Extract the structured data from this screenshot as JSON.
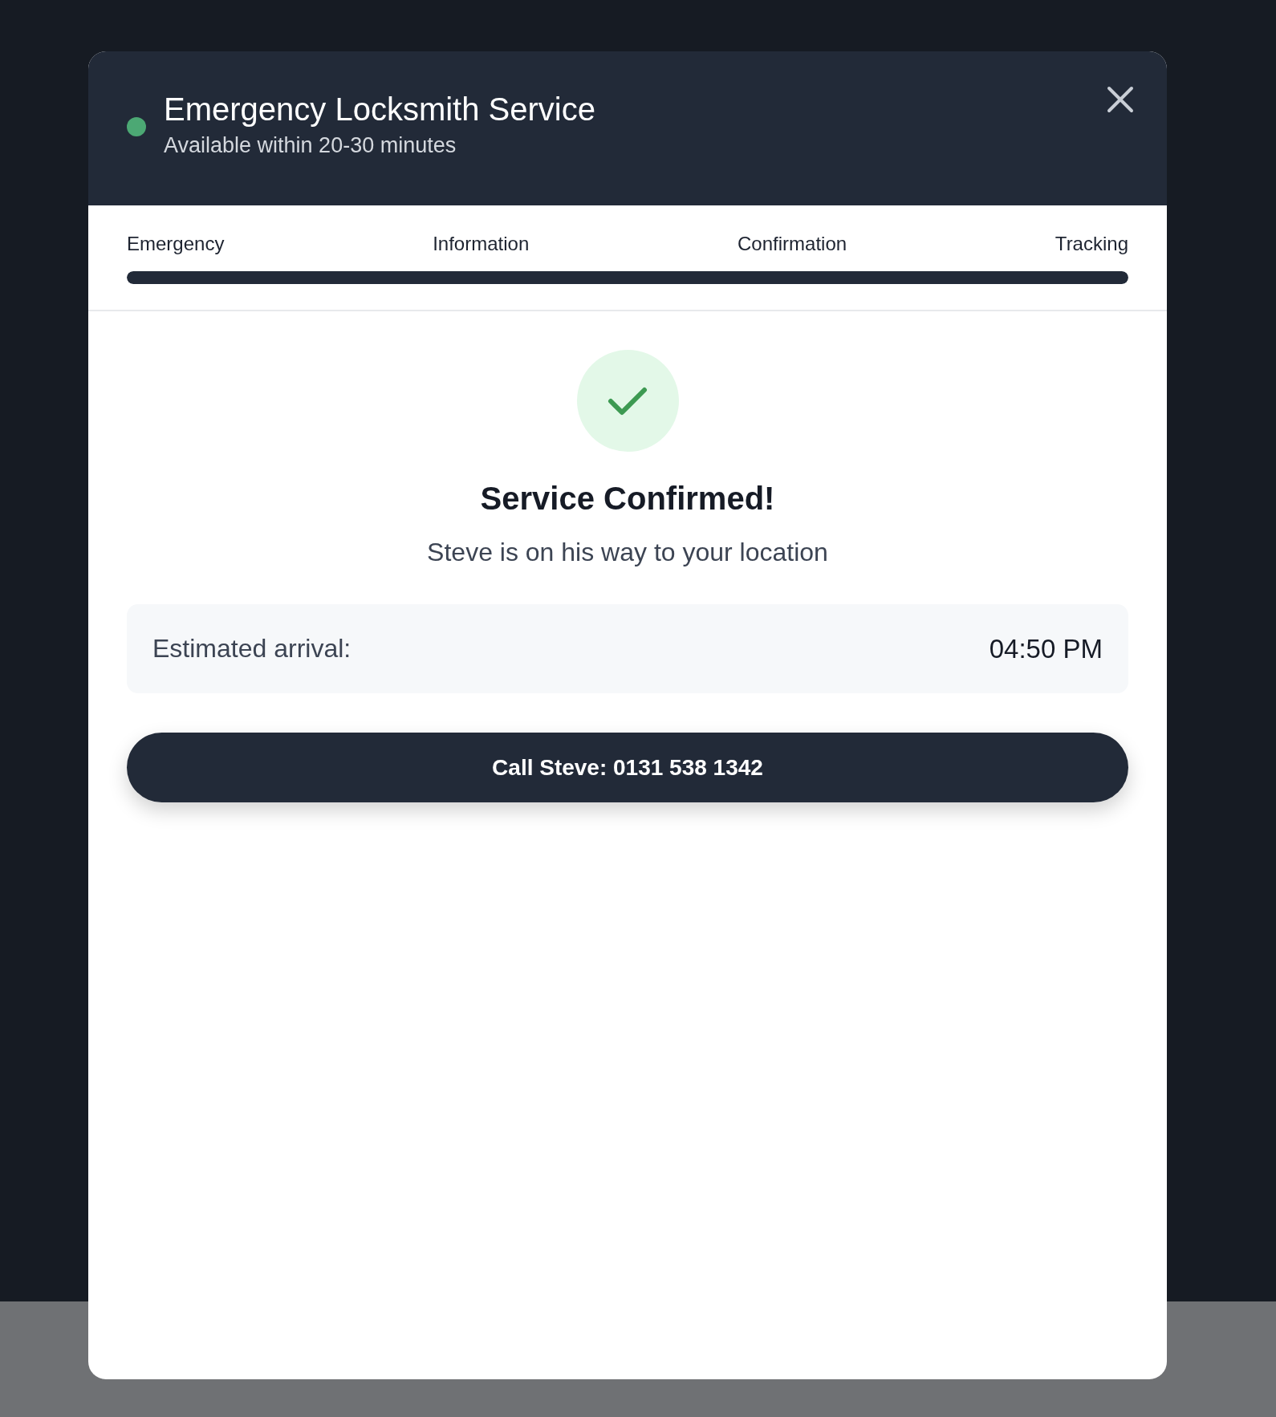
{
  "header": {
    "title": "Emergency Locksmith Service",
    "subtitle": "Available within 20-30 minutes"
  },
  "steps": [
    "Emergency",
    "Information",
    "Confirmation",
    "Tracking"
  ],
  "progress": {
    "level": 1
  },
  "confirmation": {
    "title": "Service Confirmed!",
    "message": "Steve is on his way to your location"
  },
  "eta": {
    "label": "Estimated arrival:",
    "value": "04:50 PM"
  },
  "call_button": {
    "label": "Call Steve: 0131 538 1342"
  }
}
